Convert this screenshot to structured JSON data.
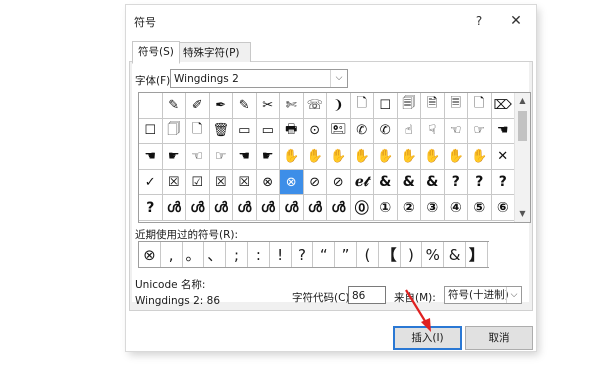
{
  "window": {
    "title": "符号",
    "help_glyph": "?",
    "close_glyph": "✕"
  },
  "tabs": [
    {
      "label": "符号(S)"
    },
    {
      "label": "特殊字符(P)"
    }
  ],
  "font": {
    "label": "字体(F):",
    "value": "Wingdings 2"
  },
  "symbol_grid": {
    "rows": [
      [
        "",
        "✎",
        "✐",
        "✒",
        "✎",
        "✂",
        "✄",
        "☏",
        "❩",
        "🗋",
        "☐",
        "🗐",
        "🗎",
        "🗏",
        "🗋",
        "⌦"
      ],
      [
        "☐",
        "🗍",
        "🗋",
        "🗑",
        "▭",
        "▭",
        "🖶",
        "⊙",
        "🖭",
        "✆",
        "✆",
        "☝",
        "☟",
        "☜",
        "☞",
        "☚"
      ],
      [
        "☚",
        "☛",
        "☜",
        "☞",
        "☚",
        "☛",
        "✋",
        "✋",
        "✋",
        "✋",
        "✋",
        "✋",
        "✋",
        "✋",
        "✋",
        "✕"
      ],
      [
        "✓",
        "☒",
        "☑",
        "☒",
        "☒",
        "⊗",
        "⊗",
        "⊘",
        "⊘",
        "ℯ𝓉",
        "&",
        "&",
        "&",
        "?",
        "?",
        "?"
      ],
      [
        "?",
        "ൾ",
        "ൾ",
        "ൾ",
        "ൾ",
        "ൾ",
        "ൾ",
        "ൾ",
        "ൾ",
        "⓪",
        "①",
        "②",
        "③",
        "④",
        "⑤",
        "⑥"
      ]
    ],
    "selected_row": 3,
    "selected_col": 6,
    "scroll_up_glyph": "▲",
    "scroll_down_glyph": "▼"
  },
  "recent": {
    "label": "近期使用过的符号(R):",
    "symbols": [
      "⊗",
      ",",
      "。",
      "、",
      ";",
      ":",
      "!",
      "?",
      "“",
      "”",
      "(",
      "【",
      ")",
      "%",
      "&",
      "】"
    ]
  },
  "unicode": {
    "label": "Unicode 名称:",
    "value": "Wingdings 2: 86"
  },
  "char_code": {
    "label": "字符代码(C):",
    "value": "86"
  },
  "from": {
    "label": "来自(M):",
    "value": "符号(十进制)"
  },
  "buttons": {
    "insert": "插入(I)",
    "cancel": "取消"
  },
  "annotation_color": "#e02020"
}
